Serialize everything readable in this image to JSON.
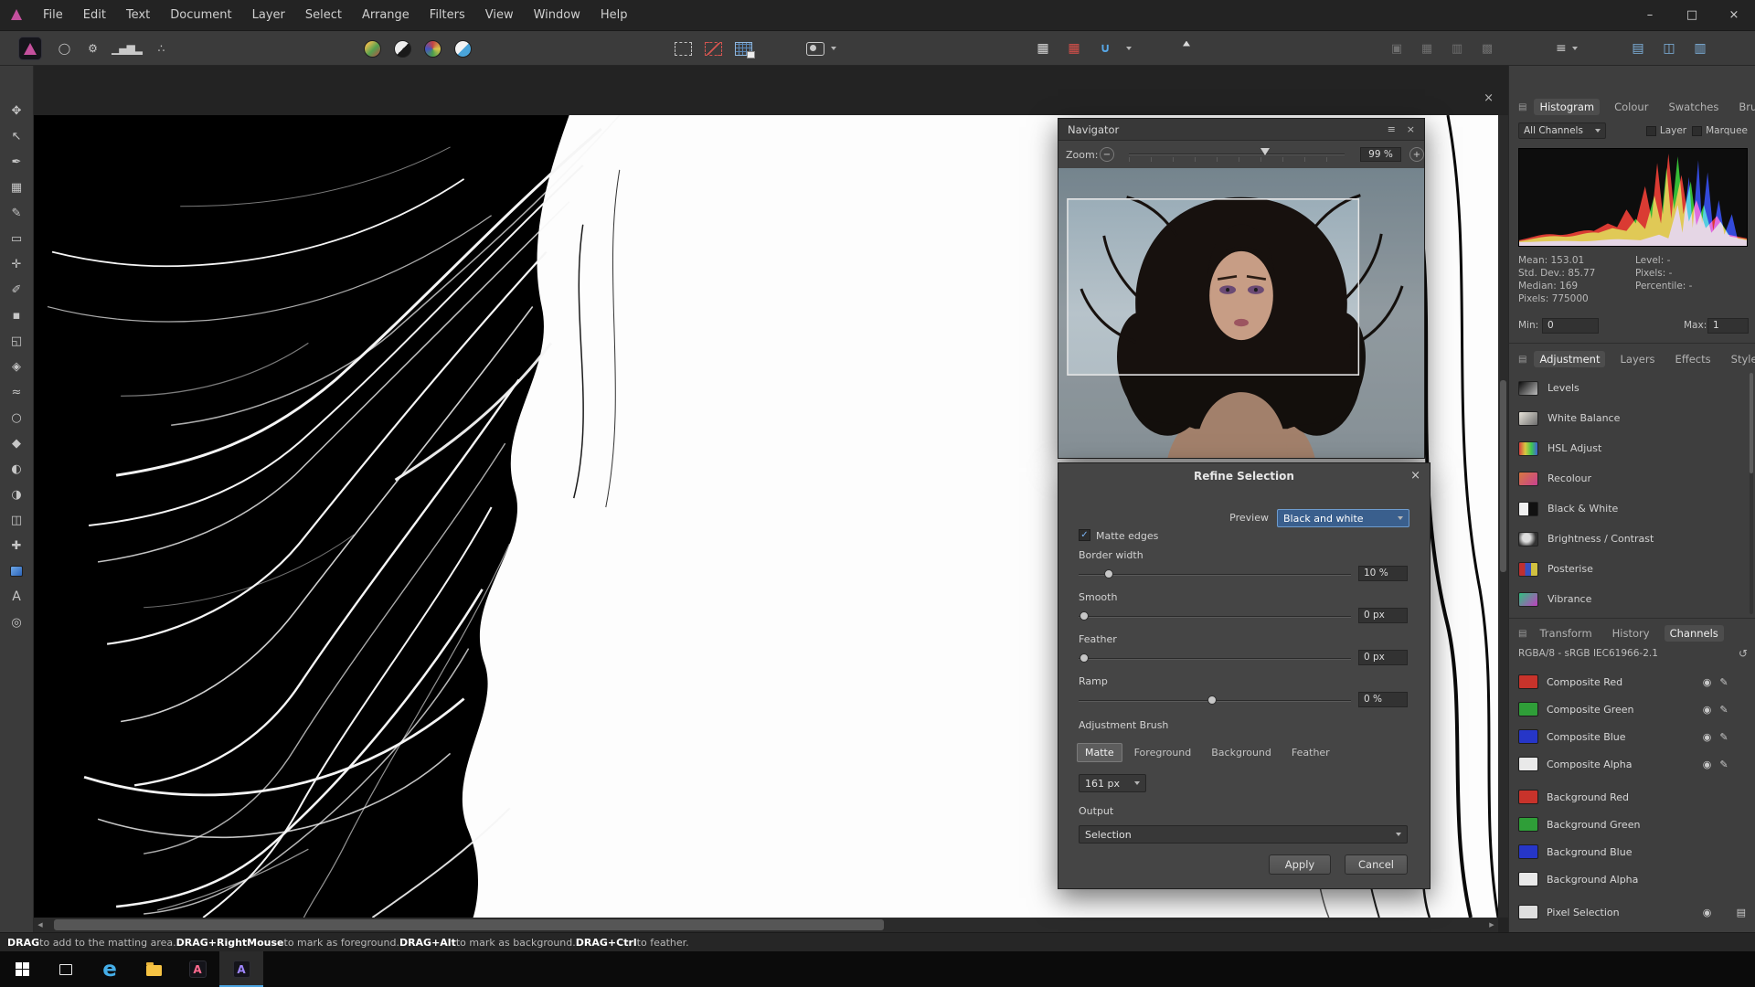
{
  "menubar": {
    "items": [
      "File",
      "Edit",
      "Text",
      "Document",
      "Layer",
      "Select",
      "Arrange",
      "Filters",
      "View",
      "Window",
      "Help"
    ]
  },
  "icons": {
    "minimize-icon": "–",
    "maximize-icon": "□",
    "close-icon": "×",
    "panel-menu-icon": "≡",
    "caret-down-icon": "▾",
    "eye-icon": "◉",
    "pencil-icon": "✎",
    "layers-grid-icon": "▤",
    "reset-icon": "↺",
    "scroll-left-icon": "◀",
    "scroll-right-icon": "▶",
    "minus-icon": "−",
    "plus-icon": "+",
    "check-icon": "✓",
    "align-icon": "≡"
  },
  "toolbar": {
    "personas": [
      {
        "name": "liquify-persona",
        "glyph": "◯"
      },
      {
        "name": "develop-persona",
        "glyph": "⚙"
      },
      {
        "name": "tone-mapping-persona",
        "glyph": "▁▄▆▂"
      },
      {
        "name": "export-persona",
        "glyph": "∴"
      }
    ],
    "autos": [
      {
        "name": "auto-levels",
        "bg": "linear-gradient(135deg,#dcb94e 20%,#55a04e 55%,#bd4a44)"
      },
      {
        "name": "auto-contrast",
        "bg": "linear-gradient(135deg,#ededed 50%,#191919 50%)"
      },
      {
        "name": "auto-colour",
        "bg": "conic-gradient(#c54343,#d6c54b,#4b9e4b,#4553c0,#c54343)"
      },
      {
        "name": "auto-white-balance",
        "bg": "linear-gradient(135deg,#f3f3f3 50%,#4aa4d9 50%)"
      }
    ],
    "selection_modes": [
      {
        "name": "marquee-new-icon",
        "kind": "plain"
      },
      {
        "name": "marquee-subtract-icon",
        "kind": "red"
      },
      {
        "name": "pixel-grid-select-icon",
        "kind": "grid"
      }
    ],
    "snapping": [
      {
        "name": "snapping-grid-icon",
        "glyph": "▦",
        "color": "#d8d8d8"
      },
      {
        "name": "pixel-align-icon",
        "glyph": "▦",
        "color": "#d8504a"
      },
      {
        "name": "snapping-magnet-icon",
        "glyph": "∪",
        "color": "#57a8e8"
      }
    ],
    "arrange": [
      {
        "name": "move-to-front-icon",
        "glyph": "▣"
      },
      {
        "name": "move-forward-icon",
        "glyph": "▦"
      },
      {
        "name": "move-backward-icon",
        "glyph": "▥"
      },
      {
        "name": "move-to-back-icon",
        "glyph": "▩"
      }
    ],
    "extras": [
      {
        "name": "view-zoom-icon",
        "glyph": "▤",
        "color": "#7fb2de"
      },
      {
        "name": "view-split-icon",
        "glyph": "◫",
        "color": "#7fb2de"
      },
      {
        "name": "view-screen-icon",
        "glyph": "▥",
        "color": "#7fb2de"
      }
    ]
  },
  "tools": [
    {
      "name": "view-tool",
      "glyph": "✥"
    },
    {
      "name": "move-tool",
      "glyph": "↖"
    },
    {
      "name": "colour-picker-tool",
      "glyph": "✒"
    },
    {
      "name": "crop-tool",
      "glyph": "▦"
    },
    {
      "name": "selection-brush-tool",
      "glyph": "✎"
    },
    {
      "name": "marquee-tool",
      "glyph": "▭"
    },
    {
      "name": "flood-select-tool",
      "glyph": "✛"
    },
    {
      "name": "paint-brush-tool",
      "glyph": "✐"
    },
    {
      "name": "pixel-tool",
      "glyph": "▪"
    },
    {
      "name": "erase-tool",
      "glyph": "◱"
    },
    {
      "name": "flood-fill-tool",
      "glyph": "◈"
    },
    {
      "name": "smudge-tool",
      "glyph": "≈"
    },
    {
      "name": "blur-tool",
      "glyph": "○"
    },
    {
      "name": "sharpen-tool",
      "glyph": "◆"
    },
    {
      "name": "dodge-tool",
      "glyph": "◐"
    },
    {
      "name": "burn-tool",
      "glyph": "◑"
    },
    {
      "name": "clone-tool",
      "glyph": "◫"
    },
    {
      "name": "healing-tool",
      "glyph": "✚"
    },
    {
      "name": "gradient-tool",
      "glyph": "",
      "style": "linear-gradient(135deg,#6ea8e8,#2b63b8)"
    },
    {
      "name": "text-tool",
      "glyph": "A"
    },
    {
      "name": "zoom-tool",
      "glyph": "◎"
    }
  ],
  "navigator": {
    "title": "Navigator",
    "zoom_label": "Zoom:",
    "zoom_value": "99 %"
  },
  "refine": {
    "title": "Refine Selection",
    "preview_label": "Preview",
    "preview_value": "Black and white",
    "matte_edges": "Matte edges",
    "border_width_label": "Border width",
    "border_width_value": "10 %",
    "smooth_label": "Smooth",
    "smooth_value": "0 px",
    "feather_label": "Feather",
    "feather_value": "0 px",
    "ramp_label": "Ramp",
    "ramp_value": "0 %",
    "adjustment_brush_label": "Adjustment Brush",
    "brush_tabs": [
      {
        "label": "Matte",
        "active": true
      },
      {
        "label": "Foreground"
      },
      {
        "label": "Background"
      },
      {
        "label": "Feather"
      }
    ],
    "brush_size": "161 px",
    "output_label": "Output",
    "output_value": "Selection",
    "apply": "Apply",
    "cancel": "Cancel"
  },
  "histogram_panel": {
    "tabs": [
      {
        "label": "Histogram",
        "active": true
      },
      {
        "label": "Colour"
      },
      {
        "label": "Swatches"
      },
      {
        "label": "Brushes"
      }
    ],
    "channel_select": "All Channels",
    "layer": "Layer",
    "marquee": "Marquee",
    "stats_left": [
      "Mean: 153.01",
      "Std. Dev.: 85.77",
      "Median: 169",
      "Pixels: 775000"
    ],
    "stats_right": [
      "Level: -",
      "Pixels: -",
      "Percentile: -"
    ],
    "min_label": "Min:",
    "min_value": "0",
    "max_label": "Max:",
    "max_value": "1"
  },
  "adjustment_panel": {
    "tabs": [
      {
        "label": "Adjustment",
        "active": true
      },
      {
        "label": "Layers"
      },
      {
        "label": "Effects"
      },
      {
        "label": "Styles"
      }
    ],
    "items": [
      {
        "label": "Levels",
        "thumb": "linear-gradient(135deg,#0c0c0c,#bdbdbd)"
      },
      {
        "label": "White Balance",
        "thumb": "linear-gradient(135deg,#e8e4da,#6d6d6d)"
      },
      {
        "label": "HSL Adjust",
        "thumb": "linear-gradient(90deg,#d84040,#d8c840,#40c850,#4060d8)"
      },
      {
        "label": "Recolour",
        "thumb": "linear-gradient(135deg,#d87840,#c84090)"
      },
      {
        "label": "Black & White",
        "thumb": "linear-gradient(90deg,#f0f0f0 50%,#111 50%)"
      },
      {
        "label": "Brightness / Contrast",
        "thumb": "radial-gradient(circle at 40% 40%,#ddd 30%,#333 70%)"
      },
      {
        "label": "Posterise",
        "thumb": "linear-gradient(90deg,#c03030 33%,#3850c0 33% 66%,#d0c040 66%)"
      },
      {
        "label": "Vibrance",
        "thumb": "linear-gradient(135deg,#30c080,#c040c0)"
      }
    ]
  },
  "channels_panel": {
    "tabs": [
      {
        "label": "Transform"
      },
      {
        "label": "History"
      },
      {
        "label": "Channels",
        "active": true
      }
    ],
    "colorspace": "RGBA/8 - sRGB IEC61966-2.1",
    "items": [
      {
        "label": "Composite Red",
        "color": "#c8332b",
        "kind": "c"
      },
      {
        "label": "Composite Green",
        "color": "#2f9e38",
        "kind": "c"
      },
      {
        "label": "Composite Blue",
        "color": "#2636c8",
        "kind": "c"
      },
      {
        "label": "Composite Alpha",
        "color": "#e9e9e9",
        "kind": "c"
      },
      {
        "label": "Background Red",
        "color": "#c8332b",
        "kind": "b",
        "gap": true
      },
      {
        "label": "Background Green",
        "color": "#2f9e38",
        "kind": "b"
      },
      {
        "label": "Background Blue",
        "color": "#2636c8",
        "kind": "b"
      },
      {
        "label": "Background Alpha",
        "color": "#e9e9e9",
        "kind": "b"
      },
      {
        "label": "Pixel Selection",
        "color": "#dedede",
        "kind": "p",
        "gap": true
      }
    ]
  },
  "status": {
    "segments": [
      {
        "text": "DRAG",
        "bold": true
      },
      {
        "text": " to add to the matting area. ",
        "bold": false
      },
      {
        "text": "DRAG+RightMouse",
        "bold": true
      },
      {
        "text": " to mark as foreground. ",
        "bold": false
      },
      {
        "text": "DRAG+Alt",
        "bold": true
      },
      {
        "text": " to mark as background. ",
        "bold": false
      },
      {
        "text": "DRAG+Ctrl",
        "bold": true
      },
      {
        "text": " to feather.",
        "bold": false
      }
    ]
  },
  "taskbar": {
    "items": [
      {
        "name": "start"
      },
      {
        "name": "task-view"
      },
      {
        "name": "edge",
        "glyph": "e",
        "glyph_color": "#45aee8"
      },
      {
        "name": "file-explorer"
      },
      {
        "name": "affinity-designer",
        "glyph": "A",
        "glyph_color": "#ff6a8e"
      },
      {
        "name": "affinity-photo",
        "glyph": "A",
        "glyph_color": "#9f86ff",
        "active": true
      }
    ]
  }
}
